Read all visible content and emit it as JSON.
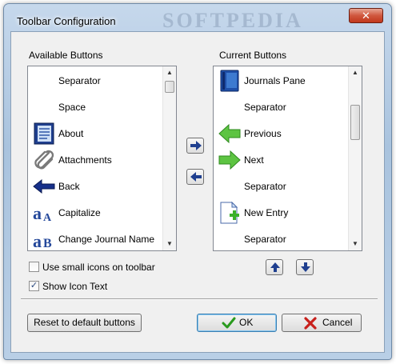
{
  "window": {
    "title": "Toolbar Configuration",
    "close_glyph": "✕"
  },
  "available": {
    "label": "Available Buttons",
    "items": [
      {
        "label": "Separator",
        "icon": ""
      },
      {
        "label": "Space",
        "icon": ""
      },
      {
        "label": "About",
        "icon": "about-book-icon"
      },
      {
        "label": "Attachments",
        "icon": "paperclip-icon"
      },
      {
        "label": "Back",
        "icon": "back-arrow-icon"
      },
      {
        "label": "Capitalize",
        "icon": "capitalize-icon"
      },
      {
        "label": "Change Journal Name",
        "icon": "change-journal-name-icon"
      }
    ]
  },
  "current": {
    "label": "Current Buttons",
    "items": [
      {
        "label": "Journals Pane",
        "icon": "journals-pane-icon"
      },
      {
        "label": "Separator",
        "icon": ""
      },
      {
        "label": "Previous",
        "icon": "previous-arrow-icon"
      },
      {
        "label": "Next",
        "icon": "next-arrow-icon"
      },
      {
        "label": "Separator",
        "icon": ""
      },
      {
        "label": "New Entry",
        "icon": "new-entry-icon"
      },
      {
        "label": "Separator",
        "icon": ""
      }
    ]
  },
  "options": {
    "small_icons_label": "Use small icons on toolbar",
    "small_icons_checked": false,
    "show_text_label": "Show Icon Text",
    "show_text_checked": true,
    "check_glyph": "✓"
  },
  "buttons": {
    "reset_label": "Reset to default buttons",
    "ok_label": "OK",
    "cancel_label": "Cancel"
  },
  "colors": {
    "accent_blue": "#1f3f8f",
    "green_arrow": "#5dc442",
    "cancel_red": "#c8201c"
  }
}
